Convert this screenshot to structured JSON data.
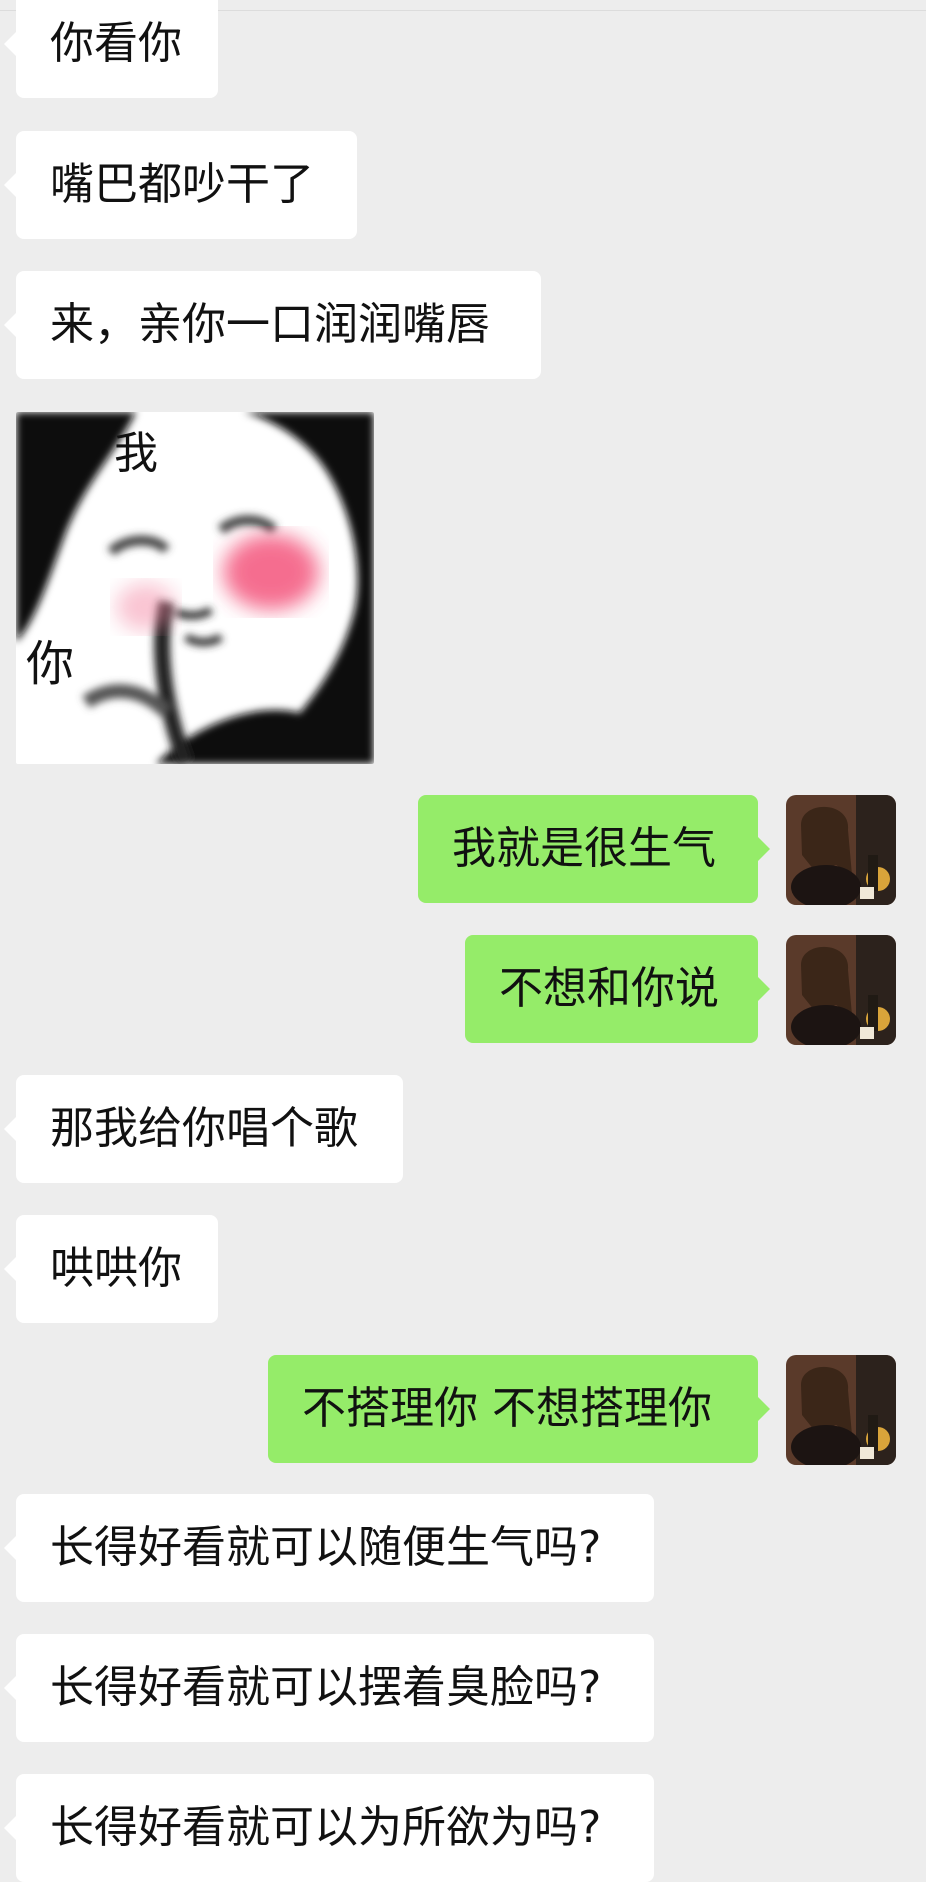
{
  "chat": {
    "messages": [
      {
        "side": "left",
        "text": "你看你"
      },
      {
        "side": "left",
        "text": "嘴巴都吵干了"
      },
      {
        "side": "left",
        "text": "来，亲你一口润润嘴唇"
      },
      {
        "side": "left",
        "type": "sticker",
        "sticker_text_top": "我",
        "sticker_text_bottom": "你"
      },
      {
        "side": "right",
        "text": "我就是很生气"
      },
      {
        "side": "right",
        "text": "不想和你说"
      },
      {
        "side": "left",
        "text": "那我给你唱个歌"
      },
      {
        "side": "left",
        "text": "哄哄你"
      },
      {
        "side": "right",
        "text": "不搭理你 不想搭理你"
      },
      {
        "side": "left",
        "text": "长得好看就可以随便生气吗?"
      },
      {
        "side": "left",
        "text": "长得好看就可以摆着臭脸吗?"
      },
      {
        "side": "left",
        "text": "长得好看就可以为所欲为吗?"
      }
    ]
  },
  "colors": {
    "background": "#ededed",
    "incoming_bubble": "#ffffff",
    "outgoing_bubble": "#95ec69"
  }
}
